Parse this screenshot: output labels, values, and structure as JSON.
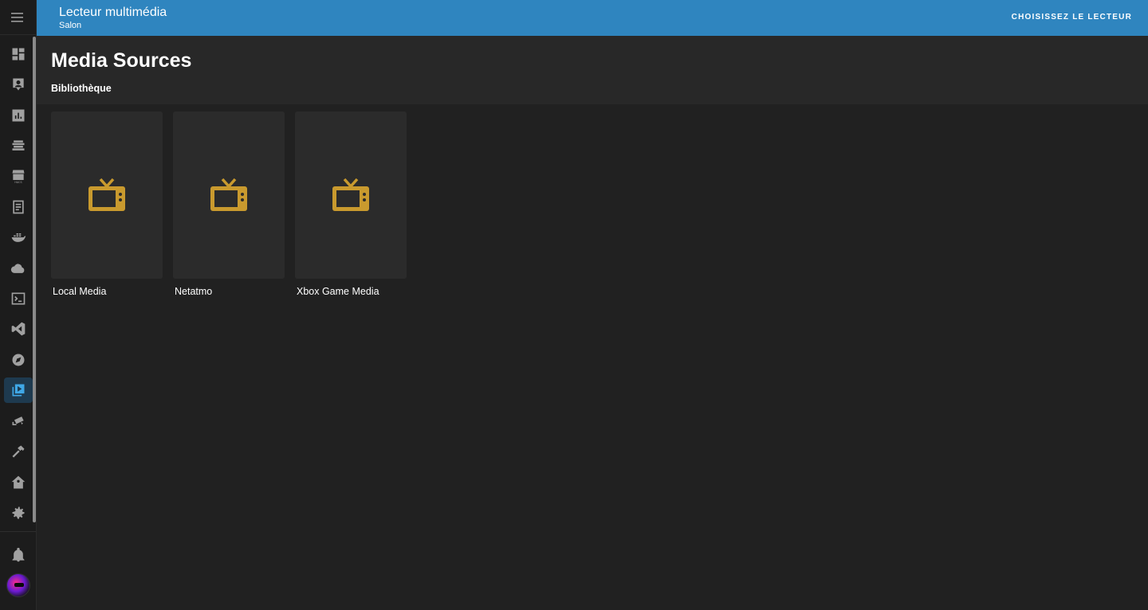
{
  "topbar": {
    "title": "Lecteur multimédia",
    "subtitle": "Salon",
    "choose_player": "CHOISISSEZ LE LECTEUR"
  },
  "header": {
    "title": "Media Sources",
    "breadcrumb": "Bibliothèque"
  },
  "sidebar": {
    "items": [
      {
        "icon": "dashboard-icon"
      },
      {
        "icon": "map-icon"
      },
      {
        "icon": "logbook-icon"
      },
      {
        "icon": "history-icon"
      },
      {
        "icon": "hacs-icon"
      },
      {
        "icon": "notes-icon"
      },
      {
        "icon": "docker-icon"
      },
      {
        "icon": "cloud-icon"
      },
      {
        "icon": "terminal-icon"
      },
      {
        "icon": "vscode-icon"
      },
      {
        "icon": "compass-icon"
      },
      {
        "icon": "media-browser-icon",
        "active": true
      },
      {
        "icon": "cctv-icon"
      },
      {
        "icon": "hammer-icon"
      },
      {
        "icon": "home-assistant-icon"
      },
      {
        "icon": "gear-icon"
      }
    ],
    "notifications_icon": "bell-icon",
    "avatar_icon": "user-avatar"
  },
  "media_sources": [
    {
      "title": "Local Media",
      "icon": "tv-icon"
    },
    {
      "title": "Netatmo",
      "icon": "tv-icon"
    },
    {
      "title": "Xbox Game Media",
      "icon": "tv-icon"
    }
  ],
  "colors": {
    "topbar": "#2f85bf",
    "icon_accent": "#c99a2e",
    "active_nav": "#1e3a4f"
  }
}
